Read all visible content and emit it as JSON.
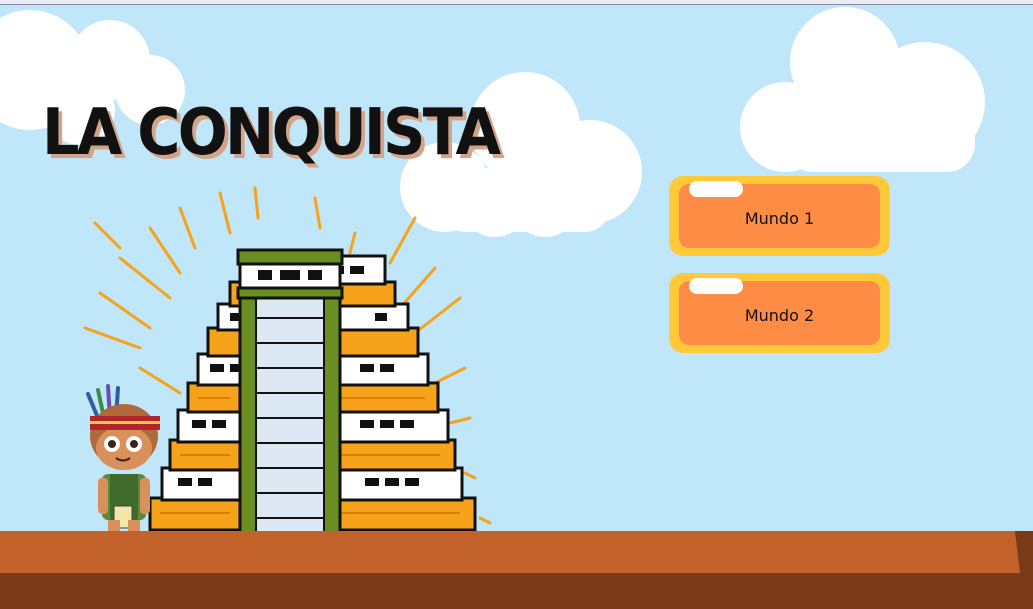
{
  "game": {
    "title": "LA CONQUISTA",
    "menu": {
      "buttons": [
        {
          "label": "Mundo 1"
        },
        {
          "label": "Mundo 2"
        }
      ]
    }
  },
  "colors": {
    "sky": "#bfe6f9",
    "button_outer": "#ffc93a",
    "button_inner": "#ff8c45",
    "ground_top": "#c2612a",
    "ground_bottom": "#7a3a17",
    "pyramid_orange": "#f7a21b",
    "pyramid_green": "#6b8e23"
  },
  "icons": [
    "cloud-icon",
    "pyramid-illustration",
    "indigenous-child-character"
  ]
}
